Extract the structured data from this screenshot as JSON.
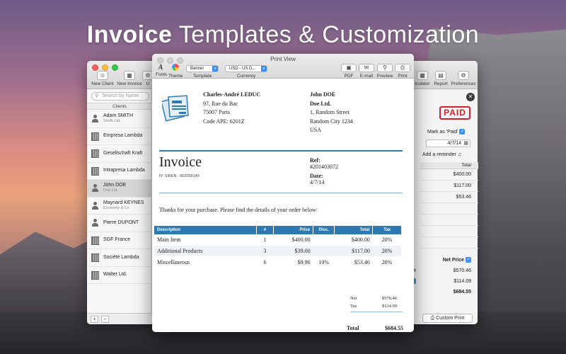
{
  "headline": {
    "bold": "Invoice",
    "rest": " Templates & Customization"
  },
  "back_window": {
    "toolbar": {
      "new_client": "New Client",
      "new_invoice": "New Invoice",
      "cut_u": "U",
      "calculator": "lculator",
      "report": "Report",
      "preferences": "Preferences"
    },
    "search_placeholder": "Search by Name",
    "clients_header": "Clients",
    "clients": [
      {
        "name": "Adam SMITH",
        "sub": "Smith Ltd.",
        "kind": "person"
      },
      {
        "name": "Empresa Lambda",
        "sub": "",
        "kind": "building"
      },
      {
        "name": "Gesellschaft Kraft",
        "sub": "",
        "kind": "building"
      },
      {
        "name": "Intrapresa Lambda",
        "sub": "",
        "kind": "building"
      },
      {
        "name": "John DOE",
        "sub": "Doe Ltd.",
        "kind": "person"
      },
      {
        "name": "Maynard KEYNES",
        "sub": "Economy & Co",
        "kind": "person"
      },
      {
        "name": "Pierre DUPONT",
        "sub": "",
        "kind": "person"
      },
      {
        "name": "SGF France",
        "sub": "",
        "kind": "building"
      },
      {
        "name": "Société Lambda",
        "sub": "",
        "kind": "building"
      },
      {
        "name": "Walter Ltd.",
        "sub": "",
        "kind": "building"
      }
    ],
    "selected_client_index": 4,
    "paid_stamp": "PAID",
    "mark_as_paid": "Mark as 'Paid'",
    "date": "4/7/14",
    "add_reminder": "Add a reminder",
    "total_header": "Total",
    "totals_col": [
      "$400.00",
      "$117.00",
      "$53.46"
    ],
    "net_price_label": "Net Price",
    "sum_lines": [
      "$570.46",
      "$114.09",
      "$684.55"
    ],
    "sum_prefixes": [
      "et",
      ""
    ],
    "custom_print": "Custom Print"
  },
  "print_view": {
    "title": "Print View",
    "fonts_label": "Fonts",
    "theme_label": "Theme",
    "template_value": "Banner",
    "template_label": "Template",
    "currency_value": "USD - US D...",
    "currency_label": "Currency",
    "pdf": "PDF",
    "email": "E-mail",
    "preview": "Preview",
    "print": "Print",
    "sender": {
      "name": "Charles-André LEDUC",
      "line1": "97, Rue du Bac",
      "line2": "75007 Paris",
      "line3": "Code APE: 6201Z"
    },
    "recipient": {
      "name": "John DOE",
      "company": "Doe Ltd.",
      "line1": "1, Random Street",
      "line2": "Random City 1234",
      "line3": "USA"
    },
    "invoice_title": "Invoice",
    "siren": "N° SIREN : 802058149",
    "ref_label": "Ref:",
    "ref_value": "#201403072",
    "date_label": "Date:",
    "date_value": "4/7/14",
    "thanks": "Thanks for your purchase. Please find the details of your order below:",
    "columns": [
      "Description",
      "#",
      "Price",
      "Disc.",
      "Total",
      "Tax"
    ],
    "items": [
      {
        "desc": "Main Item",
        "qty": "1",
        "price": "$400.00",
        "disc": "",
        "total": "$400.00",
        "tax": "20%"
      },
      {
        "desc": "Additional Products",
        "qty": "3",
        "price": "$39.00",
        "disc": "",
        "total": "$117.00",
        "tax": "20%"
      },
      {
        "desc": "Miscellaneous",
        "qty": "6",
        "price": "$9.90",
        "disc": "10%",
        "total": "$53.46",
        "tax": "20%"
      }
    ],
    "net_label": "Net",
    "net_value": "$570.46",
    "tax_label": "Tax",
    "tax_value": "$114.09",
    "total_label": "Total",
    "total_value": "$684.55"
  },
  "colors": {
    "accent": "#2e79b2",
    "paid_red": "#d8202a",
    "check_blue": "#3d8ff5"
  },
  "icons": [
    "add-person-icon",
    "new-invoice-icon",
    "calculator-icon",
    "report-icon",
    "gear-icon",
    "search-icon",
    "person-icon",
    "building-icon",
    "close-icon",
    "calendar-icon",
    "bell-icon",
    "fonts-icon",
    "theme-icon",
    "pdf-icon",
    "email-icon",
    "preview-icon",
    "print-icon"
  ]
}
